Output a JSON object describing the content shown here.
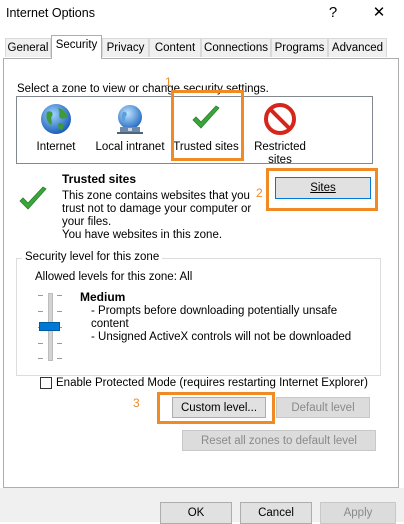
{
  "window": {
    "title": "Internet Options",
    "help_label": "?",
    "close_label": "✕"
  },
  "tabs": [
    {
      "label": "General"
    },
    {
      "label": "Security"
    },
    {
      "label": "Privacy"
    },
    {
      "label": "Content"
    },
    {
      "label": "Connections"
    },
    {
      "label": "Programs"
    },
    {
      "label": "Advanced"
    }
  ],
  "zone_prompt": "Select a zone to view or change security settings.",
  "zones": [
    {
      "label": "Internet",
      "icon": "globe-icon"
    },
    {
      "label": "Local intranet",
      "icon": "network-globe-icon"
    },
    {
      "label": "Trusted sites",
      "icon": "checkmark-icon"
    },
    {
      "label": "Restricted sites",
      "icon": "no-entry-icon"
    }
  ],
  "selected_zone": {
    "title": "Trusted sites",
    "description": "This zone contains websites that you trust not to damage your computer or your files.",
    "note": "You have websites in this zone.",
    "sites_label": "Sites"
  },
  "security_level": {
    "group_label": "Security level for this zone",
    "allowed": "Allowed levels for this zone: All",
    "level_name": "Medium",
    "bullets": [
      "- Prompts before downloading potentially unsafe content",
      "- Unsigned ActiveX controls will not be downloaded"
    ],
    "slider_level": 2
  },
  "protected_mode": {
    "label": "Enable Protected Mode (requires restarting Internet Explorer)",
    "checked": false
  },
  "buttons": {
    "custom_level": "Custom level...",
    "default_level": "Default level",
    "reset_all": "Reset all zones to default level",
    "ok": "OK",
    "cancel": "Cancel",
    "apply": "Apply"
  },
  "annotations": {
    "one": "1",
    "two": "2",
    "three": "3"
  },
  "colors": {
    "annotation": "#f08a24",
    "selection": "#0078d7",
    "check_green": "#3aa53a",
    "restricted_red": "#d6261c"
  }
}
